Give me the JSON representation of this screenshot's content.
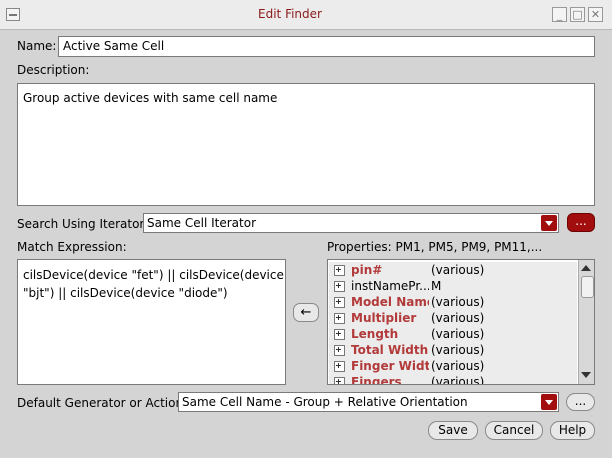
{
  "window": {
    "title": "Edit Finder",
    "controls": [
      "minimize",
      "maximize",
      "close"
    ]
  },
  "name": {
    "label": "Name:",
    "value": "Active Same Cell"
  },
  "description": {
    "label": "Description:",
    "value": "Group active devices with same cell name"
  },
  "iterator": {
    "label": "Search Using Iterator:",
    "value": "Same Cell Iterator",
    "more_label": "..."
  },
  "match": {
    "label": "Match Expression:",
    "lines": [
      "cilsDevice(device \"fet\") || cilsDevice(device",
      "\"bjt\") || cilsDevice(device \"diode\")"
    ]
  },
  "transfer_button_icon": "arrow-left-icon",
  "properties": {
    "label": "Properties: PM1, PM5, PM9, PM11,...",
    "rows": [
      {
        "name": "pin#",
        "value": "(various)",
        "highlight": true
      },
      {
        "name": "instNamePr...",
        "value": "M",
        "highlight": false
      },
      {
        "name": "Model Name",
        "value": "(various)",
        "highlight": true
      },
      {
        "name": "Multiplier",
        "value": "(various)",
        "highlight": true
      },
      {
        "name": "Length",
        "value": "(various)",
        "highlight": true
      },
      {
        "name": "Total Width",
        "value": "(various)",
        "highlight": true
      },
      {
        "name": "Finger Width",
        "value": "(various)",
        "highlight": true
      },
      {
        "name": "Fingers",
        "value": "(various)",
        "highlight": true
      }
    ]
  },
  "generator": {
    "label": "Default Generator or Action:",
    "value": "Same Cell Name - Group + Relative Orientation",
    "more_label": "..."
  },
  "buttons": {
    "save": "Save",
    "cancel": "Cancel",
    "help": "Help"
  },
  "colors": {
    "accent": "#a20e0e",
    "title": "#8b1a1a",
    "property_name": "#b23a3a"
  }
}
